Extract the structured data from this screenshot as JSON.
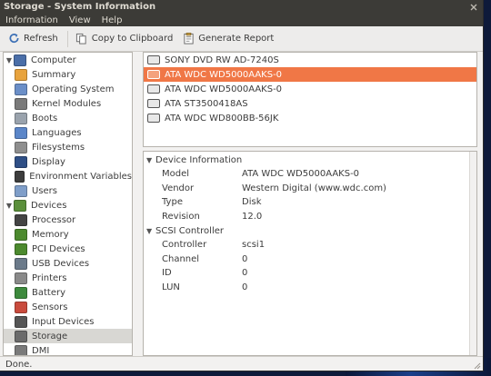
{
  "window": {
    "title": "Storage - System Information",
    "controls": [
      "close-icon"
    ]
  },
  "menu": [
    "Information",
    "View",
    "Help"
  ],
  "toolbar": {
    "refresh_label": "Refresh",
    "copy_label": "Copy to Clipboard",
    "report_label": "Generate Report"
  },
  "sidebar": {
    "items": [
      {
        "label": "Computer",
        "level": 0,
        "expander": "▼",
        "icon": "computer-icon",
        "icon_color": "#4a6ea8"
      },
      {
        "label": "Summary",
        "level": 1,
        "icon": "summary-icon",
        "icon_color": "#e8a33d"
      },
      {
        "label": "Operating System",
        "level": 1,
        "icon": "os-icon",
        "icon_color": "#6b8fc8"
      },
      {
        "label": "Kernel Modules",
        "level": 1,
        "icon": "kernel-icon",
        "icon_color": "#7a7a7a"
      },
      {
        "label": "Boots",
        "level": 1,
        "icon": "boots-icon",
        "icon_color": "#9aa3ad"
      },
      {
        "label": "Languages",
        "level": 1,
        "icon": "languages-icon",
        "icon_color": "#5b86c9"
      },
      {
        "label": "Filesystems",
        "level": 1,
        "icon": "filesystems-icon",
        "icon_color": "#8e8e8e"
      },
      {
        "label": "Display",
        "level": 1,
        "icon": "display-icon",
        "icon_color": "#2f4f86"
      },
      {
        "label": "Environment Variables",
        "level": 1,
        "icon": "env-icon",
        "icon_color": "#3d3d3d"
      },
      {
        "label": "Users",
        "level": 1,
        "icon": "users-icon",
        "icon_color": "#7f9ec9"
      },
      {
        "label": "Devices",
        "level": 0,
        "expander": "▼",
        "icon": "devices-icon",
        "icon_color": "#5a8f3a"
      },
      {
        "label": "Processor",
        "level": 1,
        "icon": "processor-icon",
        "icon_color": "#444444"
      },
      {
        "label": "Memory",
        "level": 1,
        "icon": "memory-icon",
        "icon_color": "#4c8a2e"
      },
      {
        "label": "PCI Devices",
        "level": 1,
        "icon": "pci-icon",
        "icon_color": "#4c8a2e"
      },
      {
        "label": "USB Devices",
        "level": 1,
        "icon": "usb-icon",
        "icon_color": "#6b7a8a"
      },
      {
        "label": "Printers",
        "level": 1,
        "icon": "printers-icon",
        "icon_color": "#8a8a8a"
      },
      {
        "label": "Battery",
        "level": 1,
        "icon": "battery-icon",
        "icon_color": "#3d8a3d"
      },
      {
        "label": "Sensors",
        "level": 1,
        "icon": "sensors-icon",
        "icon_color": "#c94b3d"
      },
      {
        "label": "Input Devices",
        "level": 1,
        "icon": "input-icon",
        "icon_color": "#555555"
      },
      {
        "label": "Storage",
        "level": 1,
        "icon": "storage-icon",
        "icon_color": "#6b6b6b",
        "selected": true
      },
      {
        "label": "DMI",
        "level": 1,
        "icon": "dmi-icon",
        "icon_color": "#7a7a7a"
      }
    ]
  },
  "devices": [
    {
      "label": "SONY DVD RW AD-7240S"
    },
    {
      "label": "ATA WDC WD5000AAKS-0",
      "selected": true
    },
    {
      "label": "ATA WDC WD5000AAKS-0"
    },
    {
      "label": "ATA ST3500418AS"
    },
    {
      "label": "ATA WDC WD800BB-56JK"
    }
  ],
  "details": {
    "sections": [
      {
        "title": "Device Information",
        "rows": [
          {
            "key": "Model",
            "value": "ATA WDC WD5000AAKS-0"
          },
          {
            "key": "Vendor",
            "value": "Western Digital (www.wdc.com)"
          },
          {
            "key": "Type",
            "value": "Disk"
          },
          {
            "key": "Revision",
            "value": "12.0"
          }
        ]
      },
      {
        "title": "SCSI Controller",
        "rows": [
          {
            "key": "Controller",
            "value": "scsi1"
          },
          {
            "key": "Channel",
            "value": "0"
          },
          {
            "key": "ID",
            "value": "0"
          },
          {
            "key": "LUN",
            "value": "0"
          }
        ]
      }
    ]
  },
  "status": "Done.",
  "colors": {
    "selection": "#f07746",
    "titlebar": "#3c3b37",
    "window_bg": "#f2f1f0"
  }
}
